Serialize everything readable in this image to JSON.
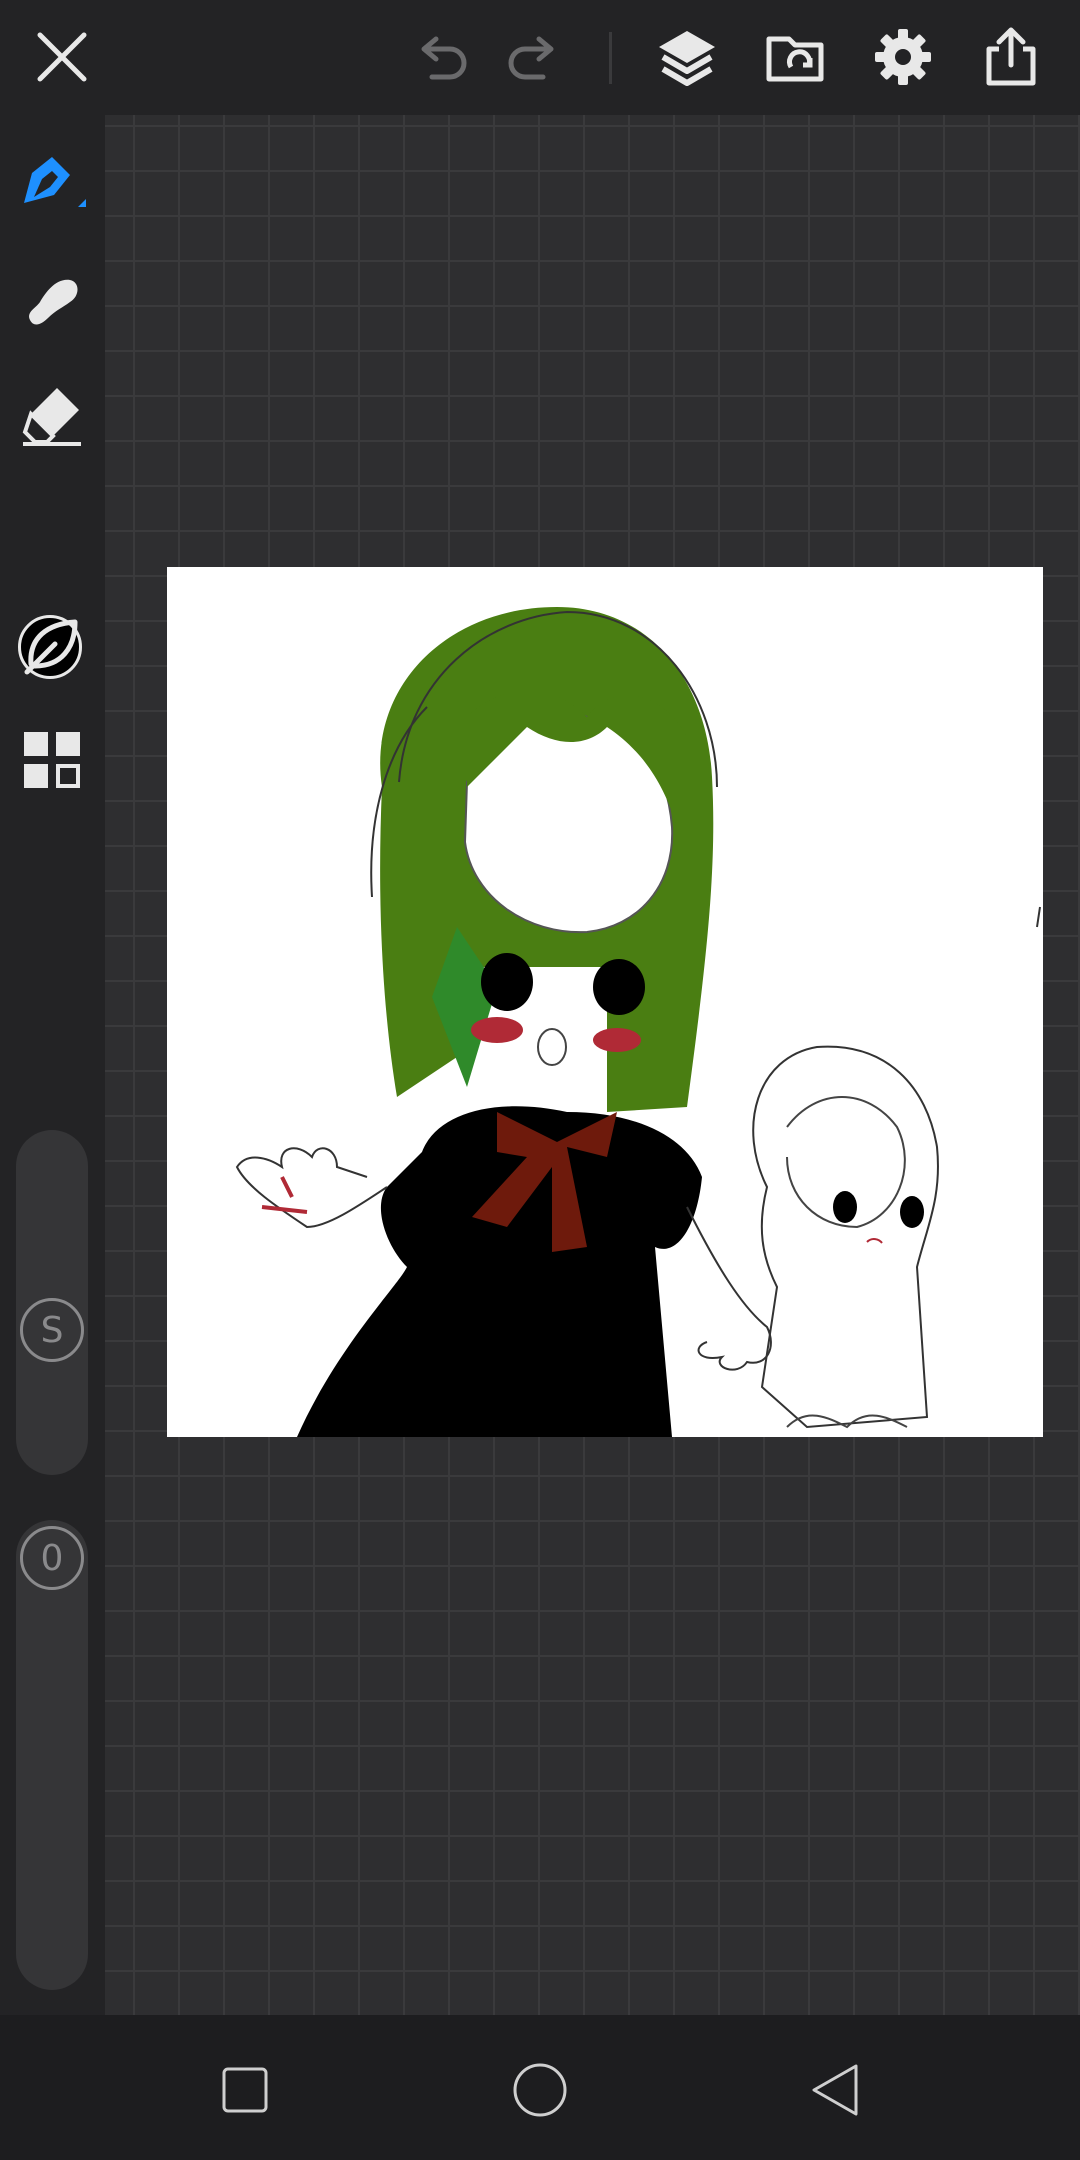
{
  "toolbar": {
    "close": "close-icon",
    "undo": "undo-icon",
    "redo": "redo-icon",
    "layers": "layers-icon",
    "import": "folder-import-icon",
    "settings": "gear-icon",
    "share": "share-icon"
  },
  "tools": {
    "pen": "pen-icon",
    "smudge": "smudge-icon",
    "eraser": "eraser-icon",
    "current_color": "#000000",
    "brush_library": "leaf-icon",
    "panels": "grid-icon"
  },
  "size_slider": {
    "label": "S"
  },
  "opacity_slider": {
    "label": "0"
  },
  "colors": {
    "accent": "#1e90ff",
    "hair": "#4a7e12",
    "dress": "#000000",
    "ribbon": "#6e1a0c",
    "cheeks": "#b02a36"
  },
  "navigation": {
    "recents": "square-icon",
    "home": "circle-icon",
    "back": "triangle-back-icon"
  }
}
